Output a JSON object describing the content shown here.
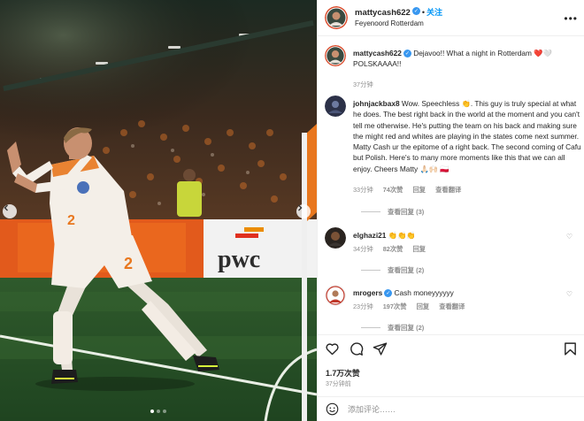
{
  "post": {
    "username": "mattycash622",
    "follow_label": "关注",
    "location": "Feyenoord Rotterdam",
    "more_icon": "more-horizontal-icon"
  },
  "photo": {
    "ad_board_text": "pwc",
    "jersey_number": "2",
    "carousel_prev_icon": "chevron-left-icon",
    "carousel_next_icon": "chevron-right-icon",
    "slide_count": 3,
    "active_slide": 1
  },
  "caption": {
    "username": "mattycash622",
    "text": "Dejavoo!! What a night in Rotterdam ❤️🤍 POLSKAAAA!!",
    "time": "37分钟"
  },
  "comments": [
    {
      "username": "johnjackbax8",
      "text": "Wow. Speechless 👏. This guy is truly special at what he does. The best right back in the world at the moment and you can't tell me otherwise. He's putting the team on his back and making sure the might red and whites are playing in the states come next summer. Matty Cash ur the epitome of a right back. The second coming of Cafu but Polish. Here's to many more moments like this that we can all enjoy. Cheers Matty 🙏🏻🙌🏻 🇵🇱",
      "time": "33分钟",
      "likes": "74次赞",
      "reply": "回复",
      "translate": "查看翻译",
      "view_replies": "查看回复 (3)"
    },
    {
      "username": "elghazi21",
      "text": "👏👏👏",
      "time": "34分钟",
      "likes": "82次赞",
      "reply": "回复",
      "translate": "",
      "view_replies": "查看回复 (2)"
    },
    {
      "username": "mrogers",
      "text": "Cash moneyyyyyy",
      "time": "23分钟",
      "likes": "197次赞",
      "reply": "回复",
      "translate": "查看翻译",
      "view_replies": "查看回复 (2)"
    }
  ],
  "actions": {
    "like_icon": "heart-icon",
    "comment_icon": "comment-icon",
    "share_icon": "send-icon",
    "save_icon": "bookmark-icon",
    "likes_count": "1.7万次赞",
    "time_ago": "37分钟前"
  },
  "add_comment": {
    "emoji_icon": "emoji-smile-icon",
    "placeholder": "添加评论……"
  },
  "colors": {
    "link_blue": "#0095f6",
    "verified_blue": "#3897f0",
    "muted_text": "#8e8e8e",
    "text": "#262626"
  }
}
